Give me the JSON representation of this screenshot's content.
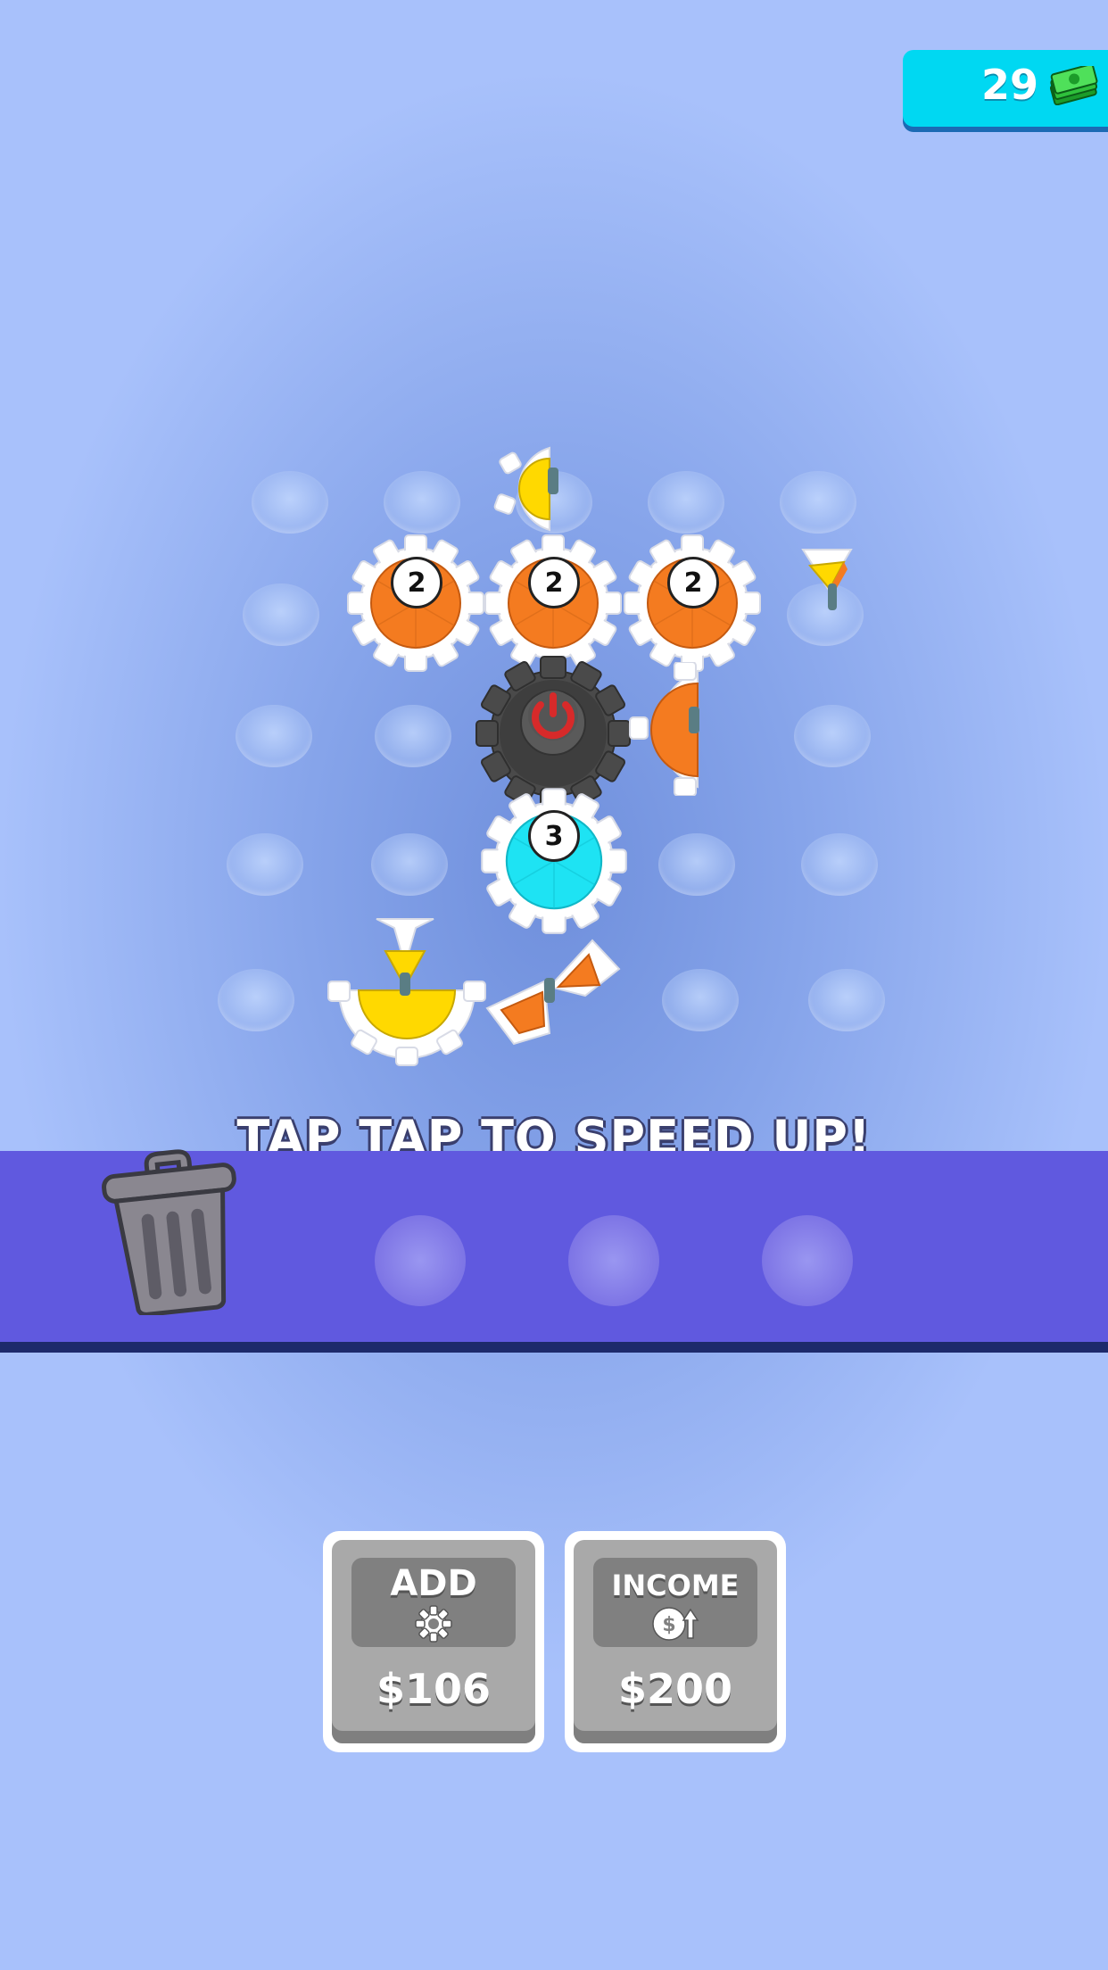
{
  "hud": {
    "money": "29",
    "money_icon": "cash-stack-icon",
    "money_color": "#00d8f2"
  },
  "board": {
    "gear_labels": [
      "2",
      "2",
      "2",
      "3"
    ],
    "colors": {
      "orange": "#f47b20",
      "yellow": "#ffd900",
      "cyan": "#1ee3f3",
      "motor": "#4a4a4a",
      "motor_button": "#d72a2a"
    }
  },
  "hint": "TAP TAP TO SPEED UP!",
  "tray": {
    "color": "#6059df",
    "trash_icon": "trash-can-icon"
  },
  "shop": {
    "add": {
      "title": "ADD",
      "icon": "gear-icon",
      "price": "$106"
    },
    "income": {
      "title": "INCOME",
      "icon": "dollar-up-icon",
      "price": "$200"
    }
  }
}
